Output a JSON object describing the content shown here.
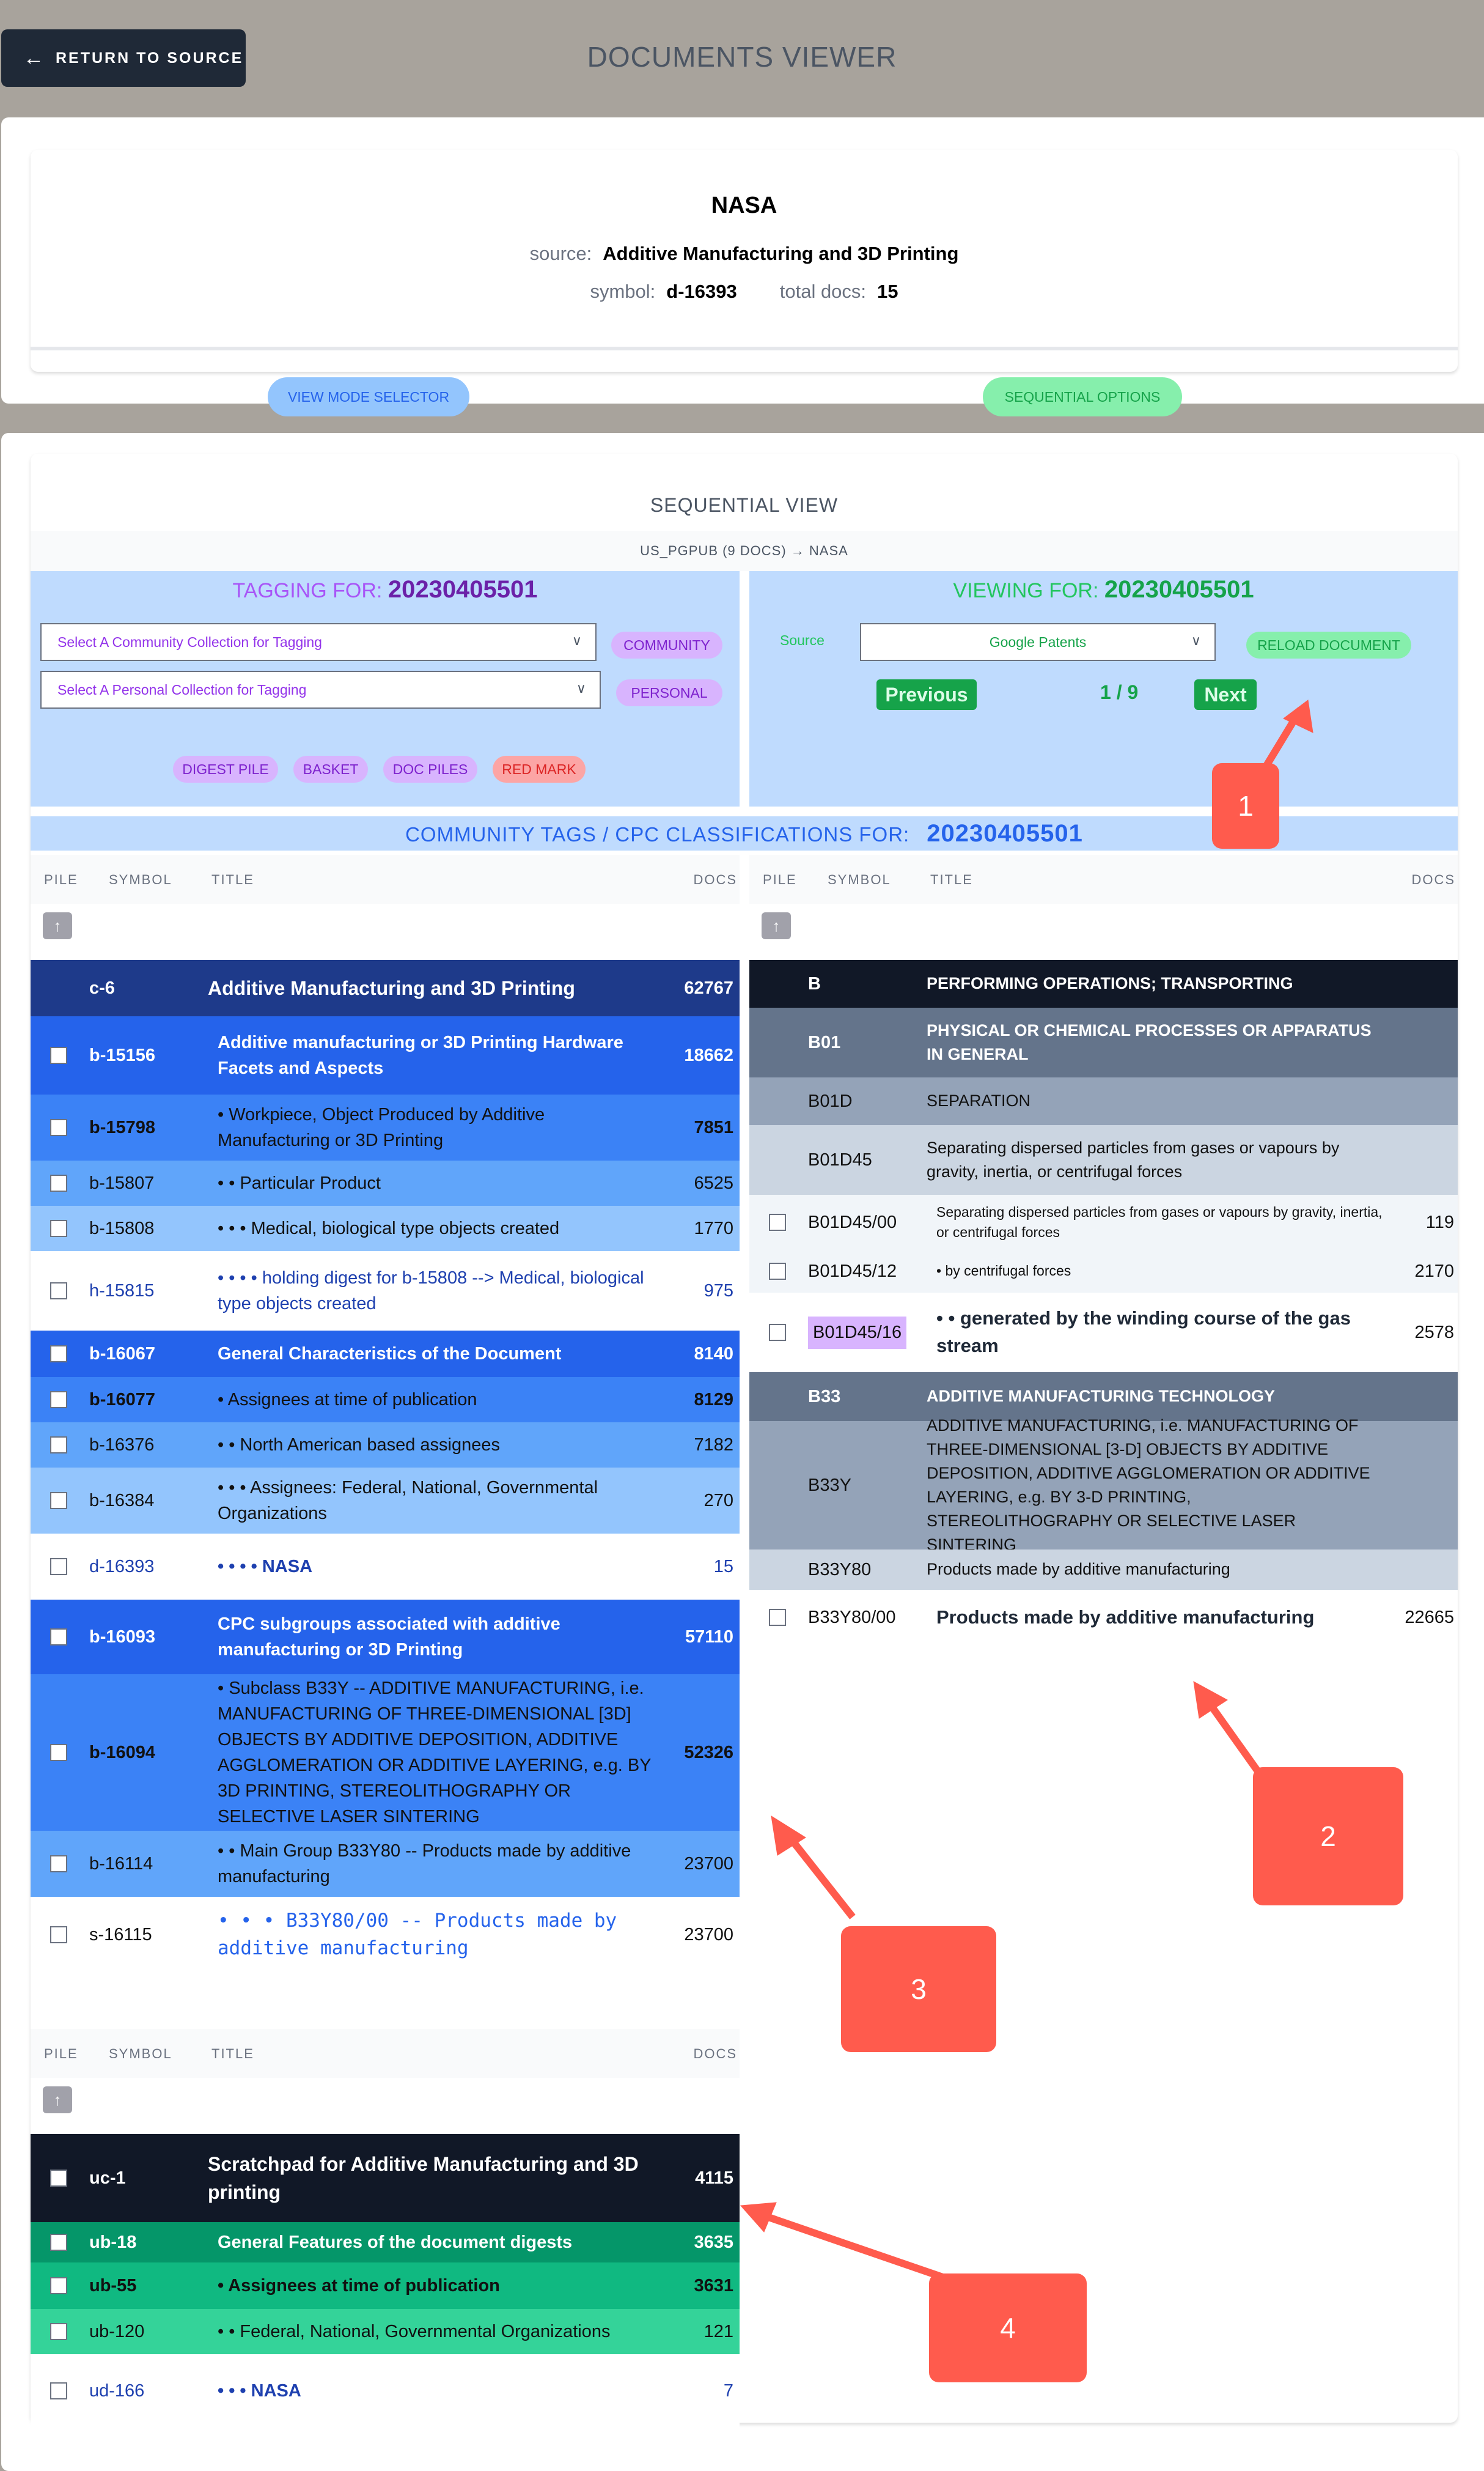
{
  "header": {
    "return_label": "RETURN TO SOURCE",
    "title": "DOCUMENTS VIEWER"
  },
  "info": {
    "name": "NASA",
    "source_label": "source:",
    "source_value": "Additive Manufacturing and 3D Printing",
    "symbol_label": "symbol:",
    "symbol_value": "d-16393",
    "total_label": "total docs:",
    "total_value": "15",
    "view_mode_label": "VIEW MODE SELECTOR",
    "sequential_options_label": "SEQUENTIAL OPTIONS"
  },
  "sequential": {
    "title": "SEQUENTIAL VIEW",
    "breadcrumb": "US_PGPUB (9 DOCS) → NASA"
  },
  "tagging": {
    "heading_label": "TAGGING FOR:",
    "doc_number": "20230405501",
    "community_select_placeholder": "Select A Community Collection for Tagging",
    "personal_select_placeholder": "Select A Personal Collection for Tagging",
    "community_btn": "COMMUNITY",
    "personal_btn": "PERSONAL",
    "digest_pile_btn": "DIGEST PILE",
    "basket_btn": "BASKET",
    "doc_piles_btn": "DOC PILES",
    "red_mark_btn": "RED MARK",
    "colors": {
      "accent": "#a855f7",
      "panel_bg": "#bfdbfe",
      "red_mark": "#fca5a5"
    }
  },
  "viewer": {
    "heading_label": "VIEWING FOR:",
    "doc_number": "20230405501",
    "source_label": "Source",
    "source_selected": "Google Patents",
    "reload_btn": "RELOAD DOCUMENT",
    "previous_btn": "Previous",
    "next_btn": "Next",
    "page_indicator": "1 / 9",
    "colors": {
      "accent": "#16a34a"
    }
  },
  "cpc_bar": {
    "label": "COMMUNITY TAGS / CPC CLASSIFICATIONS FOR:",
    "doc_number": "20230405501"
  },
  "columns": {
    "pile": "PILE",
    "symbol": "SYMBOL",
    "title": "TITLE",
    "docs": "DOCS"
  },
  "community_table": {
    "rows": [
      {
        "symbol": "c-6",
        "title": "Additive Manufacturing and 3D Printing",
        "docs": "62767",
        "checkbox": false,
        "bg": "#1e3a8a"
      },
      {
        "symbol": "b-15156",
        "title": "Additive manufacturing or 3D Printing Hardware Facets and Aspects",
        "docs": "18662",
        "checkbox": true,
        "bg": "#2563eb"
      },
      {
        "symbol": "b-15798",
        "title": "• Workpiece, Object Produced by Additive Manufacturing or 3D Printing",
        "docs": "7851",
        "checkbox": true,
        "bg": "#3b82f6"
      },
      {
        "symbol": "b-15807",
        "title": "• • Particular Product",
        "docs": "6525",
        "checkbox": true,
        "bg": "#60a5fa"
      },
      {
        "symbol": "b-15808",
        "title": "• • • Medical, biological type objects created",
        "docs": "1770",
        "checkbox": true,
        "bg": "#93c5fd"
      },
      {
        "symbol": "h-15815",
        "title": "• • • • holding digest for b-15808 --> Medical, biological type objects created",
        "docs": "975",
        "checkbox": true,
        "bg": "#ffffff"
      },
      {
        "symbol": "b-16067",
        "title": "General Characteristics of the Document",
        "docs": "8140",
        "checkbox": true,
        "bg": "#2563eb"
      },
      {
        "symbol": "b-16077",
        "title": "• Assignees at time of publication",
        "docs": "8129",
        "checkbox": true,
        "bg": "#3b82f6"
      },
      {
        "symbol": "b-16376",
        "title": "• • North American based assignees",
        "docs": "7182",
        "checkbox": true,
        "bg": "#60a5fa"
      },
      {
        "symbol": "b-16384",
        "title": "• • • Assignees: Federal, National, Governmental Organizations",
        "docs": "270",
        "checkbox": true,
        "bg": "#93c5fd"
      },
      {
        "symbol": "d-16393",
        "title": "• • • • NASA",
        "docs": "15",
        "checkbox": true,
        "bg": "#ffffff"
      },
      {
        "symbol": "b-16093",
        "title": "CPC subgroups associated with additive manufacturing or 3D Printing",
        "docs": "57110",
        "checkbox": true,
        "bg": "#2563eb"
      },
      {
        "symbol": "b-16094",
        "title": "• Subclass B33Y -- ADDITIVE MANUFACTURING, i.e. MANUFACTURING OF THREE-DIMENSIONAL [3D] OBJECTS BY ADDITIVE DEPOSITION, ADDITIVE AGGLOMERATION OR ADDITIVE LAYERING, e.g. BY 3D PRINTING, STEREOLITHOGRAPHY OR SELECTIVE LASER SINTERING",
        "docs": "52326",
        "checkbox": true,
        "bg": "#3b82f6"
      },
      {
        "symbol": "b-16114",
        "title": "• • Main Group B33Y80 -- Products made by additive manufacturing",
        "docs": "23700",
        "checkbox": true,
        "bg": "#60a5fa"
      },
      {
        "symbol": "s-16115",
        "title": "• • • B33Y80/00 -- Products made by additive manufacturing",
        "docs": "23700",
        "checkbox": true,
        "bg": "#ffffff"
      }
    ]
  },
  "cpc_table": {
    "rows": [
      {
        "symbol": "B",
        "title": "PERFORMING OPERATIONS; TRANSPORTING",
        "docs": "",
        "checkbox": false,
        "bg": "#111827"
      },
      {
        "symbol": "B01",
        "title": "PHYSICAL OR CHEMICAL PROCESSES OR APPARATUS IN GENERAL",
        "docs": "",
        "checkbox": false,
        "bg": "#64748b"
      },
      {
        "symbol": "B01D",
        "title": "SEPARATION",
        "docs": "",
        "checkbox": false,
        "bg": "#94a3b8"
      },
      {
        "symbol": "B01D45",
        "title": "Separating dispersed particles from gases or vapours by gravity, inertia, or centrifugal forces",
        "docs": "",
        "checkbox": false,
        "bg": "#cbd5e1"
      },
      {
        "symbol": "B01D45/00",
        "title": "Separating dispersed particles from gases or vapours by gravity, inertia, or centrifugal forces",
        "docs": "119",
        "checkbox": true,
        "bg": "#f1f5f9"
      },
      {
        "symbol": "B01D45/12",
        "title": "• by centrifugal forces",
        "docs": "2170",
        "checkbox": true,
        "bg": "#f1f5f9"
      },
      {
        "symbol": "B01D45/16",
        "title": "• • generated by the winding course of the gas stream",
        "docs": "2578",
        "checkbox": true,
        "bg": "#ffffff",
        "highlighted": true
      },
      {
        "symbol": "B33",
        "title": "ADDITIVE MANUFACTURING TECHNOLOGY",
        "docs": "",
        "checkbox": false,
        "bg": "#64748b"
      },
      {
        "symbol": "B33Y",
        "title": "ADDITIVE MANUFACTURING, i.e. MANUFACTURING OF THREE-DIMENSIONAL [3-D] OBJECTS BY ADDITIVE DEPOSITION, ADDITIVE AGGLOMERATION OR ADDITIVE LAYERING, e.g. BY 3-D PRINTING, STEREOLITHOGRAPHY OR SELECTIVE LASER SINTERING",
        "docs": "",
        "checkbox": false,
        "bg": "#94a3b8"
      },
      {
        "symbol": "B33Y80",
        "title": "Products made by additive manufacturing",
        "docs": "",
        "checkbox": false,
        "bg": "#cbd5e1"
      },
      {
        "symbol": "B33Y80/00",
        "title": "Products made by additive manufacturing",
        "docs": "22665",
        "checkbox": true,
        "bg": "#ffffff"
      }
    ]
  },
  "scratchpad_table": {
    "rows": [
      {
        "symbol": "uc-1",
        "title": "Scratchpad for Additive Manufacturing and 3D printing",
        "docs": "4115",
        "checkbox": true,
        "bg": "#111827"
      },
      {
        "symbol": "ub-18",
        "title": "General Features of the document digests",
        "docs": "3635",
        "checkbox": true,
        "bg": "#059669"
      },
      {
        "symbol": "ub-55",
        "title": "• Assignees at time of publication",
        "docs": "3631",
        "checkbox": true,
        "bg": "#10b981"
      },
      {
        "symbol": "ub-120",
        "title": "• • Federal, National, Governmental Organizations",
        "docs": "121",
        "checkbox": true,
        "bg": "#34d399"
      },
      {
        "symbol": "ud-166",
        "title": "• • • NASA",
        "docs": "7",
        "checkbox": true,
        "bg": "#ffffff"
      }
    ]
  },
  "annotations": [
    {
      "label": "1",
      "target": "next-button"
    },
    {
      "label": "2",
      "target": "cpc-row-B33Y80/00"
    },
    {
      "label": "3",
      "target": "community-row-b-16114"
    },
    {
      "label": "4",
      "target": "scratchpad-row-ub-18"
    }
  ],
  "icons": {
    "back": "arrow-left-icon",
    "up": "arrow-up-icon",
    "dropdown": "chevron-down-icon"
  }
}
